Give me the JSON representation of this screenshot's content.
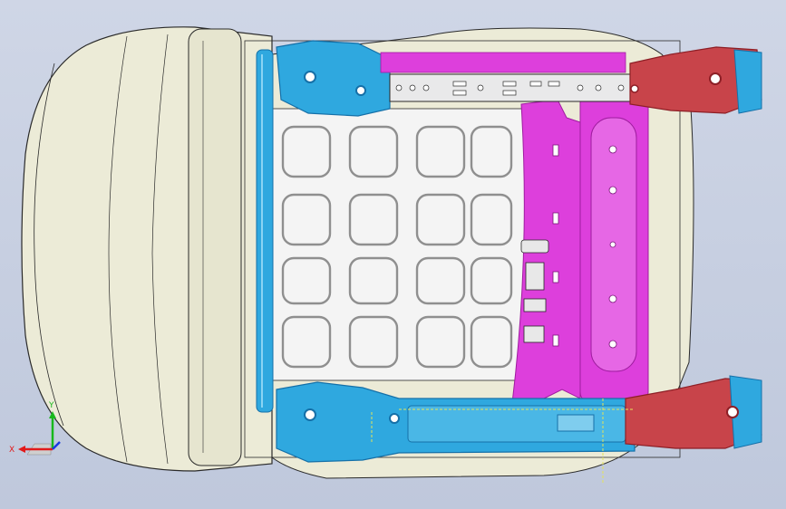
{
  "viewport": {
    "background_top": "#cfd6e6",
    "background_bottom": "#bfc8dc"
  },
  "colors": {
    "cushion": "#ecebd7",
    "cushion_shade": "#d9d8c0",
    "outline": "#2a2a2a",
    "rail_blue": "#2fa8df",
    "rail_blue_dark": "#1570a8",
    "bracket_red": "#c8444a",
    "bracket_red_dark": "#8d1f26",
    "pan_magenta": "#dd3fdc",
    "pan_magenta_dark": "#9f1c9f",
    "frame_white": "#f4f4f4",
    "wire_grey": "#9a9a9a",
    "guide_yellow": "#e3e35a"
  },
  "triad": {
    "x_label": "X",
    "y_label": "Y",
    "x_color": "#e21a1a",
    "y_color": "#18b81c",
    "z_color": "#1a3ae2"
  },
  "parts": [
    {
      "name": "seat-cushion",
      "color_key": "cushion"
    },
    {
      "name": "front-bolster",
      "color_key": "cushion"
    },
    {
      "name": "left-slide-rail",
      "color_key": "rail_blue"
    },
    {
      "name": "right-slide-rail",
      "color_key": "rail_blue"
    },
    {
      "name": "rear-mount-bracket-upper",
      "color_key": "bracket_red"
    },
    {
      "name": "rear-mount-bracket-lower",
      "color_key": "bracket_red"
    },
    {
      "name": "seat-pan",
      "color_key": "pan_magenta"
    },
    {
      "name": "spring-mat",
      "color_key": "frame_white"
    },
    {
      "name": "front-cross-tube",
      "color_key": "rail_blue"
    }
  ]
}
